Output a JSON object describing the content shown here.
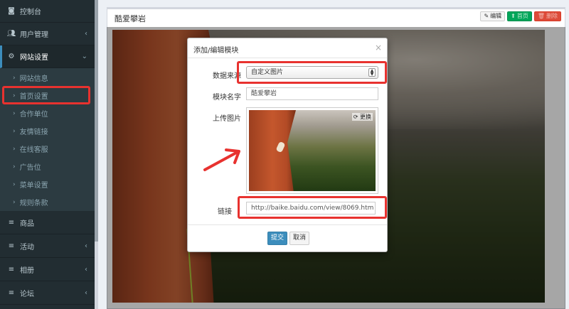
{
  "sidebar": {
    "items": [
      {
        "label": "控制台",
        "icon": "dashboard-icon"
      },
      {
        "label": "用户管理",
        "icon": "users-icon"
      },
      {
        "label": "网站设置",
        "icon": "cogs-icon"
      }
    ],
    "subitems": [
      "网站信息",
      "首页设置",
      "合作单位",
      "友情链接",
      "在线客服",
      "广告位",
      "菜单设置",
      "规则条款"
    ],
    "bottom_items": [
      "商品",
      "活动",
      "相册",
      "论坛"
    ]
  },
  "panel": {
    "title": "酷爱攀岩",
    "edit_label": "编辑",
    "home_label": "首页",
    "delete_label": "删除"
  },
  "modal": {
    "title": "添加/编辑模块",
    "close": "×",
    "source_label": "数据来源",
    "source_value": "自定义图片",
    "name_label": "模块名字",
    "name_value": "酷爱攀岩",
    "upload_label": "上传图片",
    "change_label": "更换",
    "link_label": "链接",
    "link_value": "http://baike.baidu.com/view/8069.htm",
    "submit_label": "提交",
    "cancel_label": "取消"
  },
  "colors": {
    "highlight": "#e8322f",
    "primary": "#3c8dbc",
    "sidebar_bg": "#222d32"
  }
}
